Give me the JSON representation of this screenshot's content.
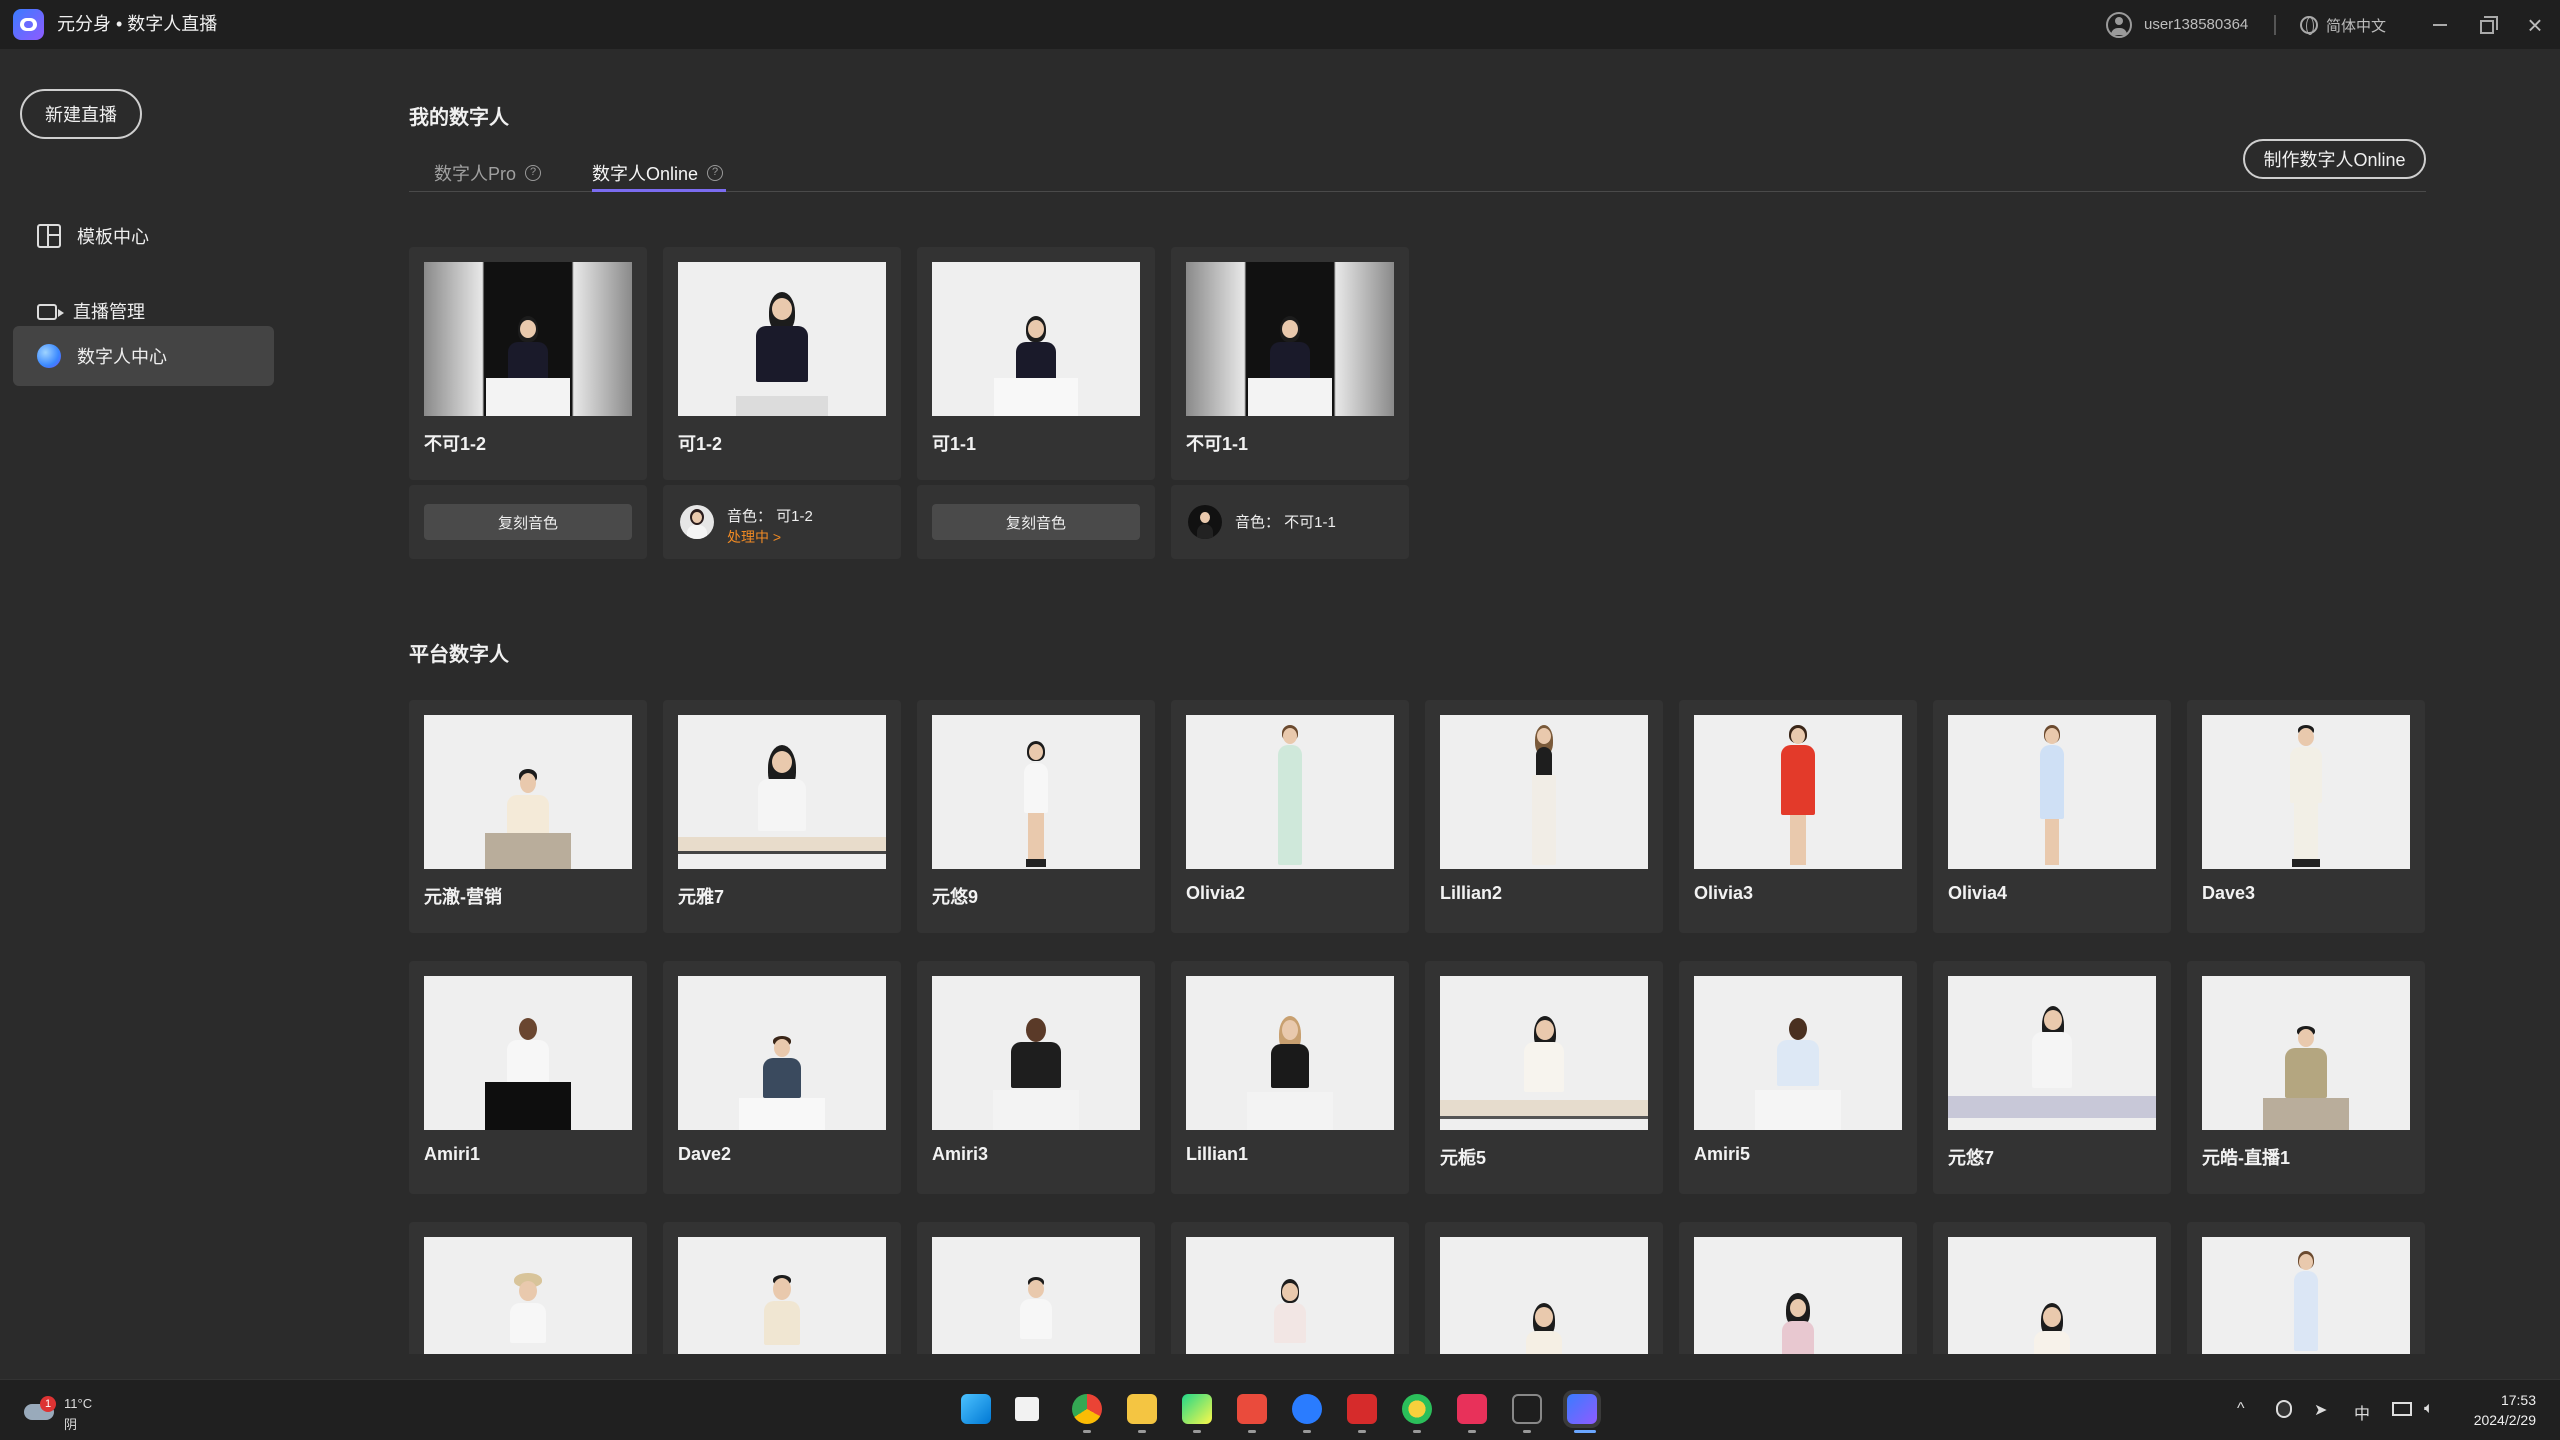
{
  "window": {
    "title": "元分身 • 数字人直播",
    "user": "user138580364",
    "language": "简体中文"
  },
  "sidebar": {
    "new_live": "新建直播",
    "items": [
      {
        "label": "模板中心",
        "icon": "template-icon"
      },
      {
        "label": "直播管理",
        "icon": "live-icon"
      },
      {
        "label": "数字人中心",
        "icon": "digital-human-icon",
        "active": true
      }
    ]
  },
  "my_digital": {
    "title": "我的数字人",
    "tabs": [
      {
        "label": "数字人Pro",
        "active": false
      },
      {
        "label": "数字人Online",
        "active": true
      }
    ],
    "help_symbol": "?",
    "make_button": "制作数字人Online",
    "cards": [
      {
        "name": "不可1-2",
        "voice": null,
        "clone_label": "复刻音色"
      },
      {
        "name": "可1-2",
        "voice": "音色： 可1-2",
        "status": "处理中 >"
      },
      {
        "name": "可1-1",
        "voice": null,
        "clone_label": "复刻音色"
      },
      {
        "name": "不可1-1",
        "voice": "音色： 不可1-1"
      }
    ]
  },
  "platform": {
    "title": "平台数字人",
    "row1": [
      "元澈-营销",
      "元雅7",
      "元悠9",
      "Olivia2",
      "Lillian2",
      "Olivia3",
      "Olivia4",
      "Dave3"
    ],
    "row2": [
      "Amiri1",
      "Dave2",
      "Amiri3",
      "Lillian1",
      "元栀5",
      "Amiri5",
      "元悠7",
      "元皓-直播1"
    ]
  },
  "taskbar": {
    "weather_badge": "1",
    "temperature": "11°C",
    "condition": "阴",
    "ime": "中",
    "time": "17:53",
    "date": "2024/2/29"
  }
}
